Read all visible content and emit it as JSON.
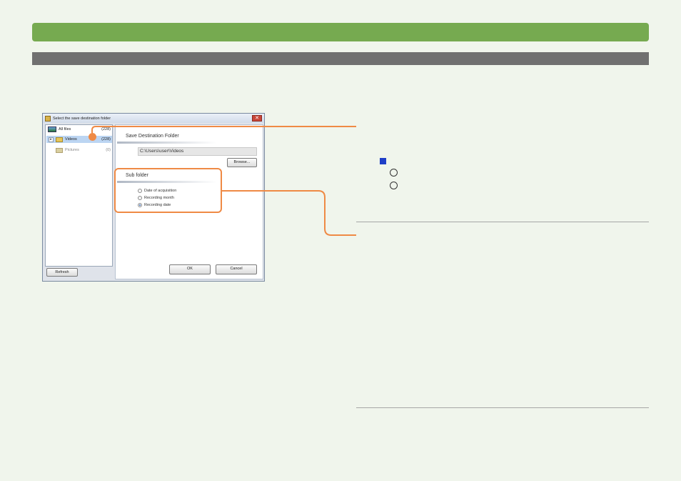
{
  "colors": {
    "title_bar": "#76aa50",
    "section_bar": "#707070",
    "callout": "#ef8a45",
    "marker": "#1f3fc8"
  },
  "dialog": {
    "title": "Select the save destination folder",
    "close_label": "✕",
    "tree": {
      "all_files": {
        "label": "All files",
        "count": "(228)"
      },
      "videos": {
        "label": "Videos",
        "count": "(228)",
        "expander": "▸"
      },
      "pictures": {
        "label": "Pictures",
        "count": "(0)"
      }
    },
    "refresh_label": "Refresh",
    "save_destination": {
      "heading": "Save Destination Folder",
      "path": "C:\\Users\\user\\Videos",
      "browse_label": "Browse..."
    },
    "sub_folder": {
      "heading": "Sub folder",
      "options": [
        {
          "label": "Date of acquisition",
          "selected": false
        },
        {
          "label": "Recording month",
          "selected": false
        },
        {
          "label": "Recording date",
          "selected": true
        }
      ]
    },
    "ok_label": "OK",
    "cancel_label": "Cancel"
  }
}
